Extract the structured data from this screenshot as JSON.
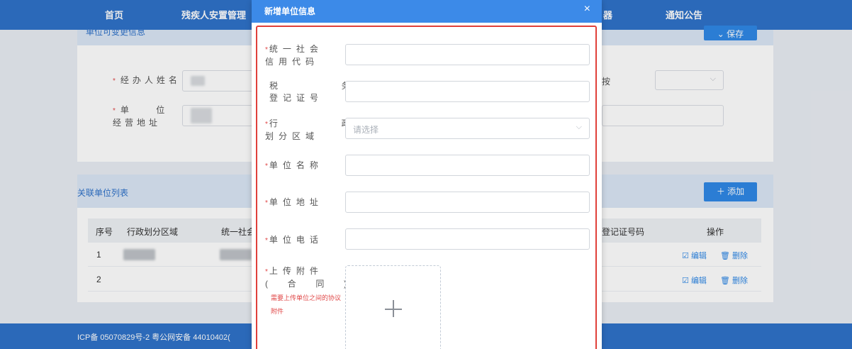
{
  "nav": {
    "items": [
      "首页",
      "残疾人安置管理",
      "器",
      "通知公告"
    ]
  },
  "top_panel": {
    "title": "单位可变更信息",
    "save_label": "⌄ 保存",
    "fields": [
      {
        "label": "经办人姓名"
      },
      {
        "label": "单    位\n经营地址"
      }
    ],
    "right_select_text": "按"
  },
  "list_panel": {
    "title": "关联单位列表",
    "add_label": "＋ 添加",
    "columns": [
      "序号",
      "行政划分区域",
      "统一社会",
      "登记证号码",
      "操作"
    ],
    "rows": [
      {
        "index": "1",
        "edit": "编辑",
        "delete": "删除"
      },
      {
        "index": "2",
        "edit": "编辑",
        "delete": "删除"
      }
    ]
  },
  "footer": {
    "text": "ICP备 05070829号-2 粤公网安备 44010402("
  },
  "dialog": {
    "title": "新增单位信息",
    "close": "×",
    "fields": [
      {
        "label": "统一社会\n信用代码",
        "required": true
      },
      {
        "label": "税        务\n登记证号",
        "required": false
      },
      {
        "label": "行        政\n划分区域",
        "required": true,
        "placeholder": "请选择"
      },
      {
        "label": "单位名称",
        "required": true
      },
      {
        "label": "单位地址",
        "required": true
      },
      {
        "label": "单位电话",
        "required": true
      },
      {
        "label": "上传附件\n(  合  同  )",
        "required": true
      }
    ],
    "upload_hint": "需要上传单位之间的协议附件"
  },
  "colors": {
    "nav": "#2f72c9",
    "dialog_header": "#3c8ae8",
    "required": "#e04848",
    "highlight_border": "#e0403a"
  }
}
